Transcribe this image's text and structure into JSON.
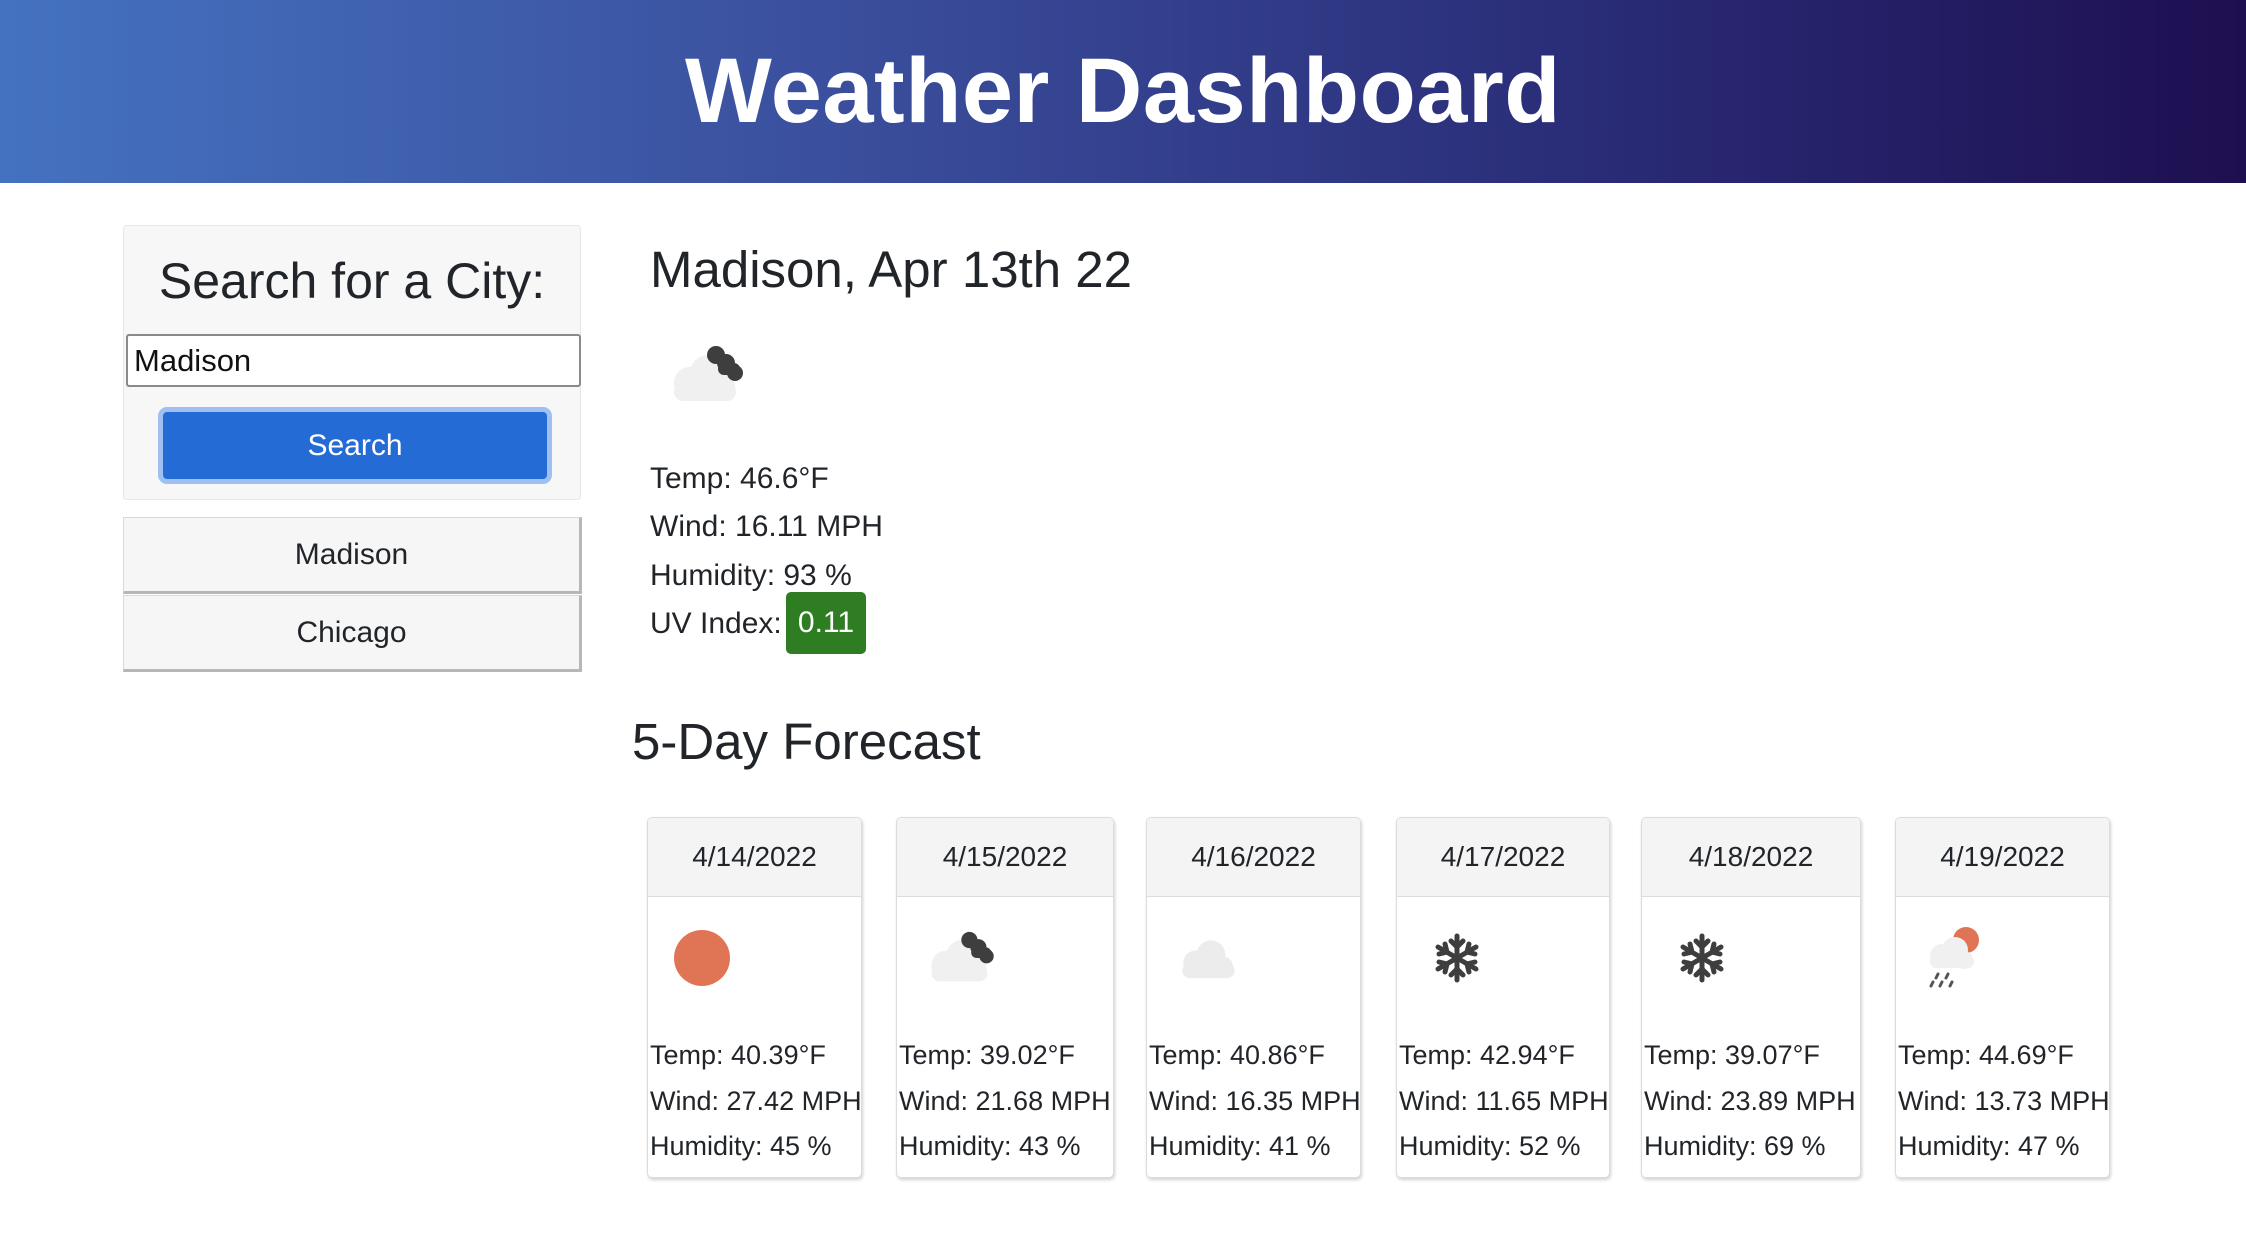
{
  "header": {
    "title": "Weather Dashboard"
  },
  "search": {
    "title": "Search for a City:",
    "input_value": "Madison",
    "button_label": "Search"
  },
  "history": [
    {
      "label": "Madison"
    },
    {
      "label": "Chicago"
    }
  ],
  "current": {
    "title": "Madison, Apr 13th 22",
    "icon": "cloudy-dark-icon",
    "temp": "Temp: 46.6°F",
    "wind": "Wind: 16.11 MPH",
    "humidity": "Humidity: 93 %",
    "uv_label": "UV Index:",
    "uv_value": "0.11",
    "uv_color": "#2e7d22"
  },
  "forecast": {
    "title": "5-Day Forecast",
    "days": [
      {
        "date": "4/14/2022",
        "icon": "sun-icon",
        "temp": "Temp: 40.39°F",
        "wind": "Wind: 27.42 MPH",
        "humidity": "Humidity: 45 %"
      },
      {
        "date": "4/15/2022",
        "icon": "cloudy-dark-icon",
        "temp": "Temp: 39.02°F",
        "wind": "Wind: 21.68 MPH",
        "humidity": "Humidity: 43 %"
      },
      {
        "date": "4/16/2022",
        "icon": "cloud-icon",
        "temp": "Temp: 40.86°F",
        "wind": "Wind: 16.35 MPH",
        "humidity": "Humidity: 41 %"
      },
      {
        "date": "4/17/2022",
        "icon": "snowflake-icon",
        "temp": "Temp: 42.94°F",
        "wind": "Wind: 11.65 MPH",
        "humidity": "Humidity: 52 %"
      },
      {
        "date": "4/18/2022",
        "icon": "snowflake-icon",
        "temp": "Temp: 39.07°F",
        "wind": "Wind: 23.89 MPH",
        "humidity": "Humidity: 69 %"
      },
      {
        "date": "4/19/2022",
        "icon": "rain-sun-icon",
        "temp": "Temp: 44.69°F",
        "wind": "Wind: 13.73 MPH",
        "humidity": "Humidity: 47 %"
      }
    ]
  }
}
